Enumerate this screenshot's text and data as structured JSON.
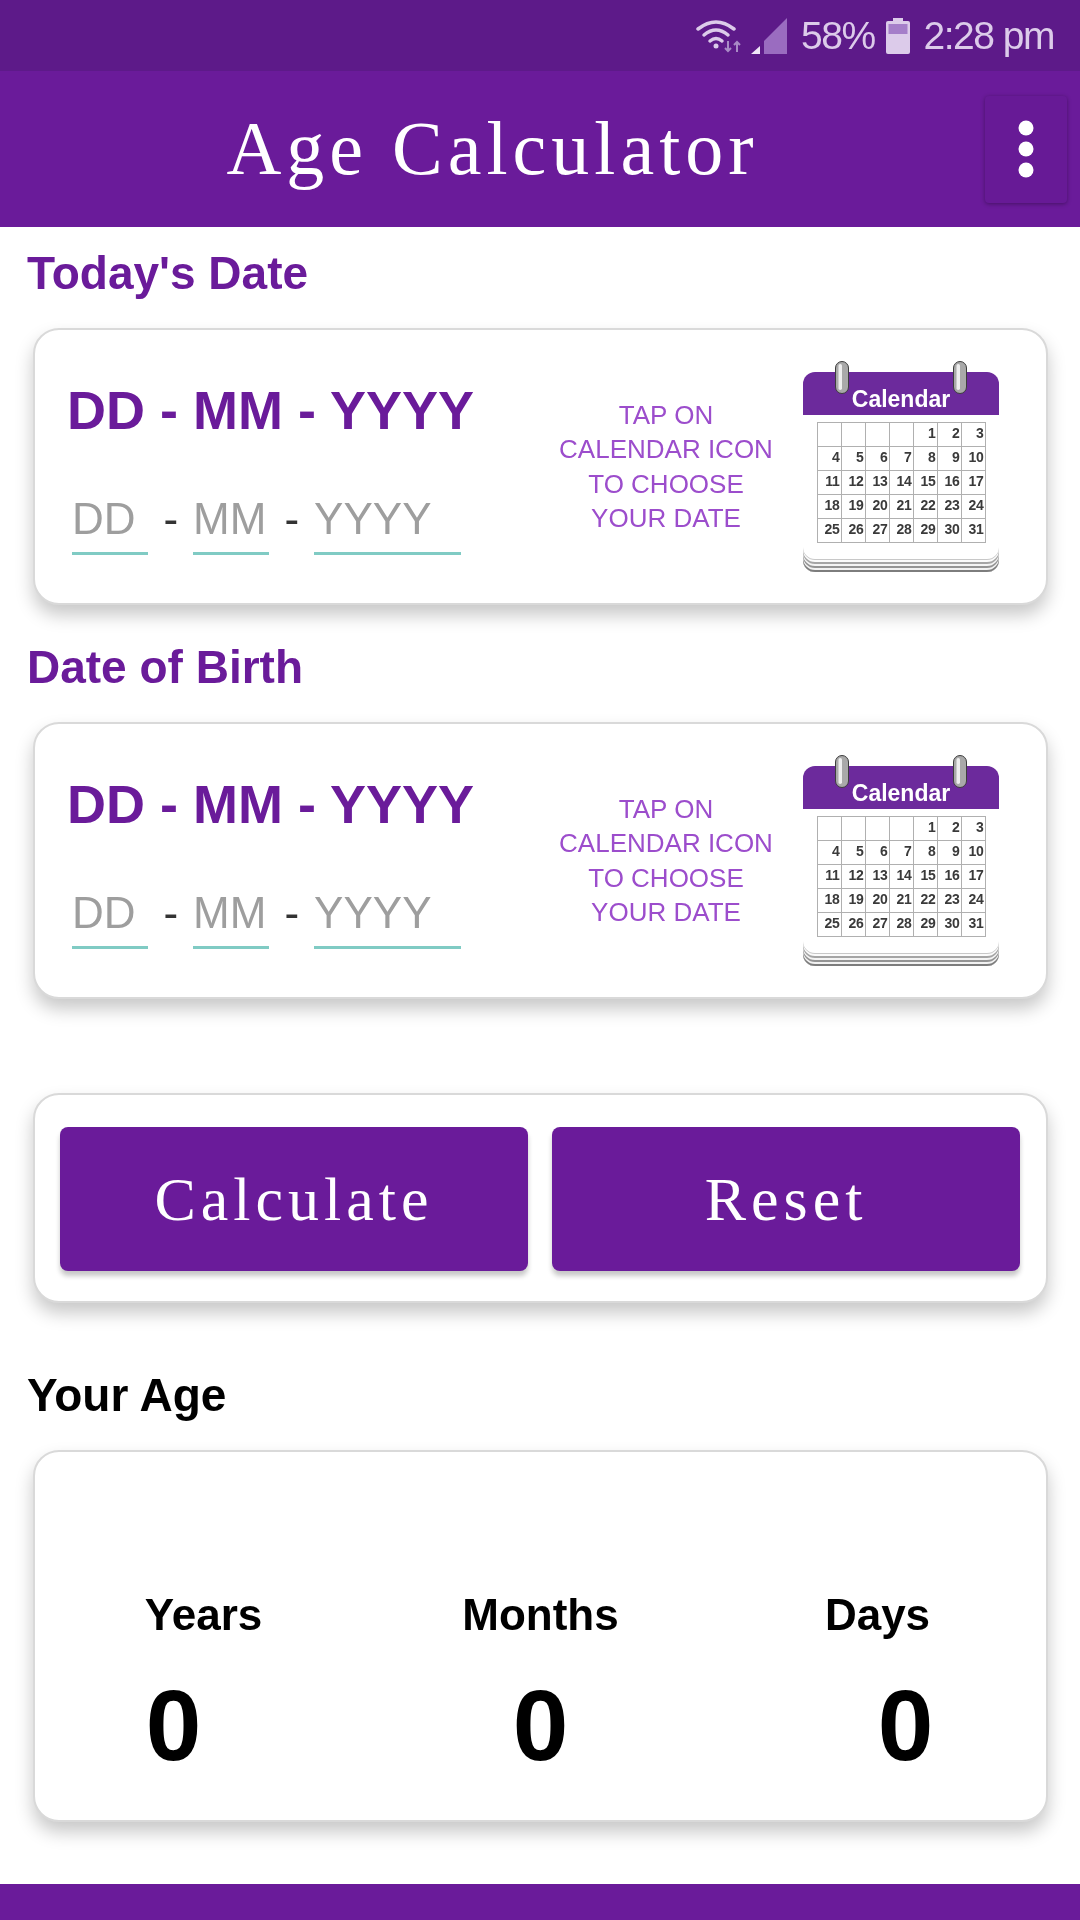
{
  "status_bar": {
    "battery": "58%",
    "time": "2:28 pm"
  },
  "app_bar": {
    "title": "Age Calculator"
  },
  "date_sections": [
    {
      "heading": "Today's Date",
      "format": "DD - MM - YYYY",
      "fields": [
        {
          "kind": "input",
          "placeholder": "DD"
        },
        {
          "kind": "separator",
          "text": "-"
        },
        {
          "kind": "input",
          "placeholder": "MM"
        },
        {
          "kind": "separator",
          "text": "-"
        },
        {
          "kind": "input",
          "placeholder": "YYYY"
        }
      ],
      "hint_lines": [
        "TAP ON",
        "CALENDAR ICON",
        "TO CHOOSE",
        "YOUR DATE"
      ],
      "calendar": {
        "label": "Calendar",
        "days": [
          "1",
          "2",
          "3",
          "4",
          "5",
          "6",
          "7",
          "8",
          "9",
          "10",
          "11",
          "12",
          "13",
          "14",
          "15",
          "16",
          "17",
          "18",
          "19",
          "20",
          "21",
          "22",
          "23",
          "24",
          "25",
          "26",
          "27",
          "28",
          "29",
          "30",
          "31"
        ]
      }
    },
    {
      "heading": "Date of Birth",
      "format": "DD - MM - YYYY",
      "fields": [
        {
          "kind": "input",
          "placeholder": "DD"
        },
        {
          "kind": "separator",
          "text": "-"
        },
        {
          "kind": "input",
          "placeholder": "MM"
        },
        {
          "kind": "separator",
          "text": "-"
        },
        {
          "kind": "input",
          "placeholder": "YYYY"
        }
      ],
      "hint_lines": [
        "TAP ON",
        "CALENDAR ICON",
        "TO CHOOSE",
        "YOUR DATE"
      ],
      "calendar": {
        "label": "Calendar",
        "days": [
          "1",
          "2",
          "3",
          "4",
          "5",
          "6",
          "7",
          "8",
          "9",
          "10",
          "11",
          "12",
          "13",
          "14",
          "15",
          "16",
          "17",
          "18",
          "19",
          "20",
          "21",
          "22",
          "23",
          "24",
          "25",
          "26",
          "27",
          "28",
          "29",
          "30",
          "31"
        ]
      }
    }
  ],
  "buttons": [
    {
      "label": "Calculate"
    },
    {
      "label": "Reset"
    }
  ],
  "age_heading": "Your Age",
  "results": [
    {
      "label": "Years",
      "value": "0"
    },
    {
      "label": "Months",
      "value": "0"
    },
    {
      "label": "Days",
      "value": "0"
    }
  ]
}
